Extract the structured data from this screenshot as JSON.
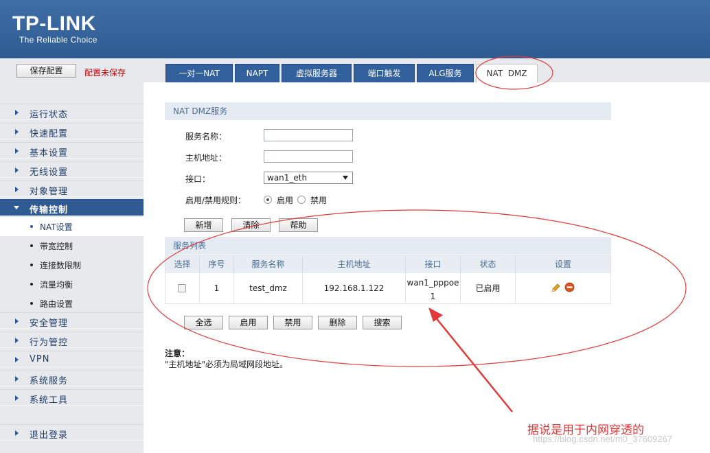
{
  "brand": {
    "logo": "TP-LINK",
    "slogan": "The Reliable Choice"
  },
  "toolbar": {
    "save_label": "保存配置",
    "unsaved_text": "配置未保存"
  },
  "tabs": [
    {
      "label": "一对一NAT"
    },
    {
      "label": "NAPT"
    },
    {
      "label": "虚拟服务器"
    },
    {
      "label": "端口触发"
    },
    {
      "label": "ALG服务"
    },
    {
      "label": "NAT  DMZ"
    }
  ],
  "sidebar": {
    "items": [
      {
        "label": "运行状态"
      },
      {
        "label": "快速配置"
      },
      {
        "label": "基本设置"
      },
      {
        "label": "无线设置"
      },
      {
        "label": "对象管理"
      },
      {
        "label": "传输控制"
      },
      {
        "label": "安全管理"
      },
      {
        "label": "行为管控"
      },
      {
        "label": "VPN"
      },
      {
        "label": "系统服务"
      },
      {
        "label": "系统工具"
      },
      {
        "label": "退出登录"
      }
    ],
    "subitems": [
      {
        "label": "NAT设置"
      },
      {
        "label": "带宽控制"
      },
      {
        "label": "连接数限制"
      },
      {
        "label": "流量均衡"
      },
      {
        "label": "路由设置"
      }
    ]
  },
  "form": {
    "section_title": "NAT DMZ服务",
    "service_name_label": "服务名称：",
    "service_name_value": "",
    "host_addr_label": "主机地址：",
    "host_addr_value": "",
    "interface_label": "接口：",
    "interface_value": "wan1_eth",
    "rule_label": "启用/禁用规则：",
    "enable_label": "启用",
    "disable_label": "禁用",
    "add_label": "新增",
    "clear_label": "清除",
    "help_label": "帮助"
  },
  "list": {
    "section_title": "服务列表",
    "headers": [
      "选择",
      "序号",
      "服务名称",
      "主机地址",
      "接口",
      "状态",
      "设置"
    ],
    "rows": [
      {
        "index": "1",
        "name": "test_dmz",
        "host": "192.168.1.122",
        "iface_line1": "wan1_pppoe",
        "iface_line2": "1",
        "status": "已启用"
      }
    ],
    "select_all_label": "全选",
    "enable_label": "启用",
    "disable_label": "禁用",
    "delete_label": "删除",
    "search_label": "搜索"
  },
  "note": {
    "title": "注意：",
    "body": "\"主机地址\"必须为局域网段地址。"
  },
  "annotation": {
    "text": "据说是用于内网穿透的",
    "color": "#e03a3a"
  },
  "watermark": {
    "text": "https://blog.csdn.net/m0_37609267"
  },
  "icons": {
    "edit": "pencil-icon",
    "delete": "minus-circle-icon"
  }
}
